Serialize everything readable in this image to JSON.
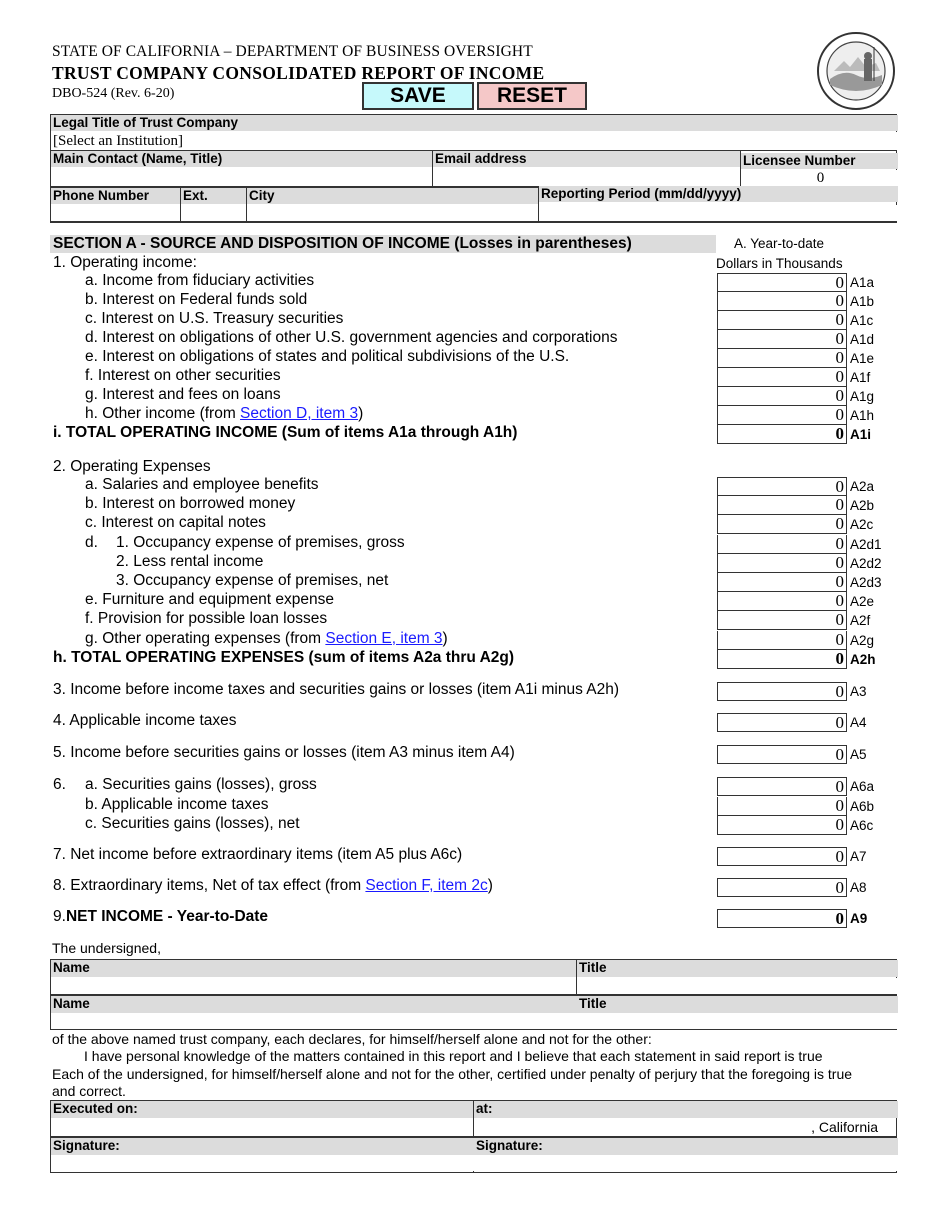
{
  "header": {
    "agency": "STATE OF CALIFORNIA – DEPARTMENT OF BUSINESS OVERSIGHT",
    "title": "TRUST COMPANY CONSOLIDATED REPORT OF INCOME",
    "form_id": "DBO-524  (Rev. 6-20)",
    "seal_icon": "california-state-seal"
  },
  "toolbar": {
    "save_label": "SAVE",
    "reset_label": "RESET"
  },
  "info": {
    "legal_title_label": "Legal Title of Trust Company",
    "legal_title_value": "[Select an Institution]",
    "main_contact_label": "Main Contact (Name, Title)",
    "main_contact_value": "",
    "email_label": "Email address",
    "email_value": "",
    "licensee_label": "Licensee Number",
    "licensee_value": "0",
    "phone_label": "Phone Number",
    "phone_value": "",
    "ext_label": "Ext.",
    "ext_value": "",
    "city_label": "City",
    "city_value": "",
    "period_label": "Reporting Period (mm/dd/yyyy)",
    "period_value": ""
  },
  "section_a": {
    "title": "SECTION A - SOURCE AND DISPOSITION OF INCOME (Losses in parentheses)",
    "col_header_1": "A. Year-to-date",
    "col_header_2": "Dollars in Thousands",
    "group1_label": "1. Operating income:",
    "group1": [
      {
        "label": "a. Income from fiduciary activities",
        "value": "0",
        "code": "A1a"
      },
      {
        "label": "b. Interest on Federal funds sold",
        "value": "0",
        "code": "A1b"
      },
      {
        "label": "c. Interest on U.S. Treasury securities",
        "value": "0",
        "code": "A1c"
      },
      {
        "label": "d. Interest on obligations of other U.S. government agencies and corporations",
        "value": "0",
        "code": "A1d"
      },
      {
        "label": "e. Interest on obligations of states and political subdivisions of the U.S.",
        "value": "0",
        "code": "A1e"
      },
      {
        "label": "f.  Interest on other securities",
        "value": "0",
        "code": "A1f"
      },
      {
        "label": "g. Interest and fees on loans",
        "value": "0",
        "code": "A1g"
      },
      {
        "label": "h. Other income (from ",
        "link": "Section D, item 3",
        "suffix": ")",
        "value": "0",
        "code": "A1h"
      },
      {
        "label": "i. TOTAL OPERATING INCOME (Sum of items A1a through A1h)",
        "value": "0",
        "code": "A1i"
      }
    ],
    "group2_label": "2. Operating Expenses",
    "group2": [
      {
        "label": "a. Salaries and employee benefits",
        "value": "0",
        "code": "A2a"
      },
      {
        "label": "b. Interest on borrowed money",
        "value": "0",
        "code": "A2b"
      },
      {
        "label": "c. Interest on capital notes",
        "value": "0",
        "code": "A2c"
      },
      {
        "prefix": "d.",
        "label": "1.  Occupancy expense of premises, gross",
        "value": "0",
        "code": "A2d1"
      },
      {
        "label": "2.  Less rental income",
        "value": "0",
        "code": "A2d2"
      },
      {
        "label": "3.  Occupancy expense of premises, net",
        "value": "0",
        "code": "A2d3"
      },
      {
        "label": "e. Furniture and equipment expense",
        "value": "0",
        "code": "A2e"
      },
      {
        "label": "f.  Provision for possible loan losses",
        "value": "0",
        "code": "A2f"
      },
      {
        "label": "g. Other operating expenses (from ",
        "link": "Section E, item 3",
        "suffix": ")",
        "value": "0",
        "code": "A2g"
      },
      {
        "label": "h. TOTAL OPERATING EXPENSES (sum of items A2a thru A2g)",
        "value": "0",
        "code": "A2h"
      }
    ],
    "item3": {
      "label": "3. Income before income taxes and securities gains or losses (item A1i minus A2h)",
      "value": "0",
      "code": "A3"
    },
    "item4": {
      "label": "4. Applicable income taxes",
      "value": "0",
      "code": "A4"
    },
    "item5": {
      "label": "5. Income before securities gains or losses (item A3 minus item A4)",
      "value": "0",
      "code": "A5"
    },
    "item6_prefix": "6.",
    "group6": [
      {
        "label": "a.  Securities gains (losses), gross",
        "value": "0",
        "code": "A6a"
      },
      {
        "label": "b.  Applicable income taxes",
        "value": "0",
        "code": "A6b"
      },
      {
        "label": "c.  Securities gains (losses), net",
        "value": "0",
        "code": "A6c"
      }
    ],
    "item7": {
      "label": "7. Net income before extraordinary items (item A5 plus A6c)",
      "value": "0",
      "code": "A7"
    },
    "item8": {
      "label": "8. Extraordinary items, Net of tax effect (from ",
      "link": "Section F, item 2c",
      "suffix": ")",
      "value": "0",
      "code": "A8"
    },
    "item9": {
      "prefix": "9. ",
      "label": "NET INCOME - Year-to-Date",
      "value": "0",
      "code": "A9"
    }
  },
  "attestation": {
    "undersigned": "The undersigned,",
    "name_label": "Name",
    "title_label": "Title",
    "name1_value": "",
    "title1_value": "",
    "name2_value": "",
    "title2_value": "",
    "declare_line": "of the above named trust company, each declares, for himself/herself alone and not for the other:",
    "knowledge_line": "I have personal knowledge of the matters contained in this report and I believe that each statement in said report is true",
    "certify_line_1": "Each of the undersigned, for himself/herself alone and not for the other, certified under penalty of perjury that the foregoing is true",
    "certify_line_2": "and correct.",
    "executed_label": "Executed on:",
    "executed_value": "",
    "at_label": "at:",
    "at_suffix": ", California",
    "signature_label": "Signature:",
    "signature1_value": "",
    "signature2_value": ""
  }
}
